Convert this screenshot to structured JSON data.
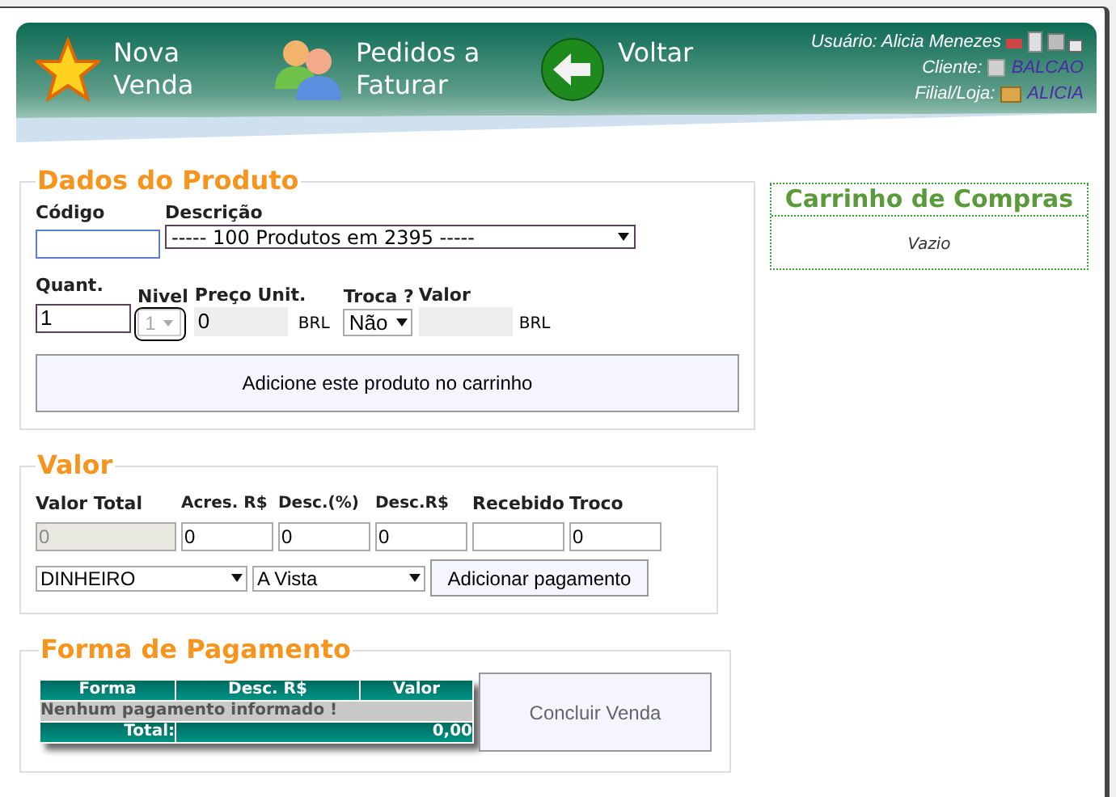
{
  "header": {
    "nav": [
      {
        "label": "Nova Venda",
        "kind": "star"
      },
      {
        "label": "Pedidos a Faturar",
        "kind": "people"
      },
      {
        "label": "Voltar",
        "kind": "back"
      }
    ],
    "user": "Usuário: Alicia Menezes",
    "client_label": "Cliente:",
    "client": "BALCAO",
    "store_label": "Filial/Loja:",
    "store": "ALICIA"
  },
  "product": {
    "legend": "Dados do Produto",
    "code_label": "Código",
    "description_label": "Descrição",
    "description_value": "----- 100 Produtos em 2395 -----",
    "quantity_label": "Quant.",
    "quantity": "1",
    "level_label": "Nivel",
    "level_value": "1",
    "level_disabled": true,
    "price_label": "Preço Unit.",
    "price": "0",
    "currency_1": "BRL",
    "exchange_label": "Troca ?",
    "exchange_value": "Não",
    "value_label": "Valor",
    "currency_2": "BRL",
    "add_button": "Adicione este produto no carrinho"
  },
  "cart": {
    "title": "Carrinho de Compras",
    "empty": "Vazio"
  },
  "value": {
    "legend": "Valor",
    "fields": [
      {
        "label": "Valor Total",
        "value": "0",
        "disabled": true
      },
      {
        "label": "Acres. R$",
        "value": "0",
        "disabled": false
      },
      {
        "label": "Desc.(%)",
        "value": "0",
        "disabled": false
      },
      {
        "label": "Desc.R$",
        "value": "0",
        "disabled": false
      },
      {
        "label": "Recebido",
        "disabled": false
      },
      {
        "label": "Troco",
        "value": "0",
        "disabled": false
      }
    ],
    "method": "DINHEIRO",
    "terms": "A Vista",
    "add_payment": "Adicionar pagamento"
  },
  "payment": {
    "legend": "Forma de Pagamento",
    "columns": [
      "Forma",
      "Desc. R$",
      "Valor"
    ],
    "empty": "Nenhum pagamento informado !",
    "total_label": "Total:",
    "total": "0,00",
    "finish_button": "Concluir Venda"
  }
}
